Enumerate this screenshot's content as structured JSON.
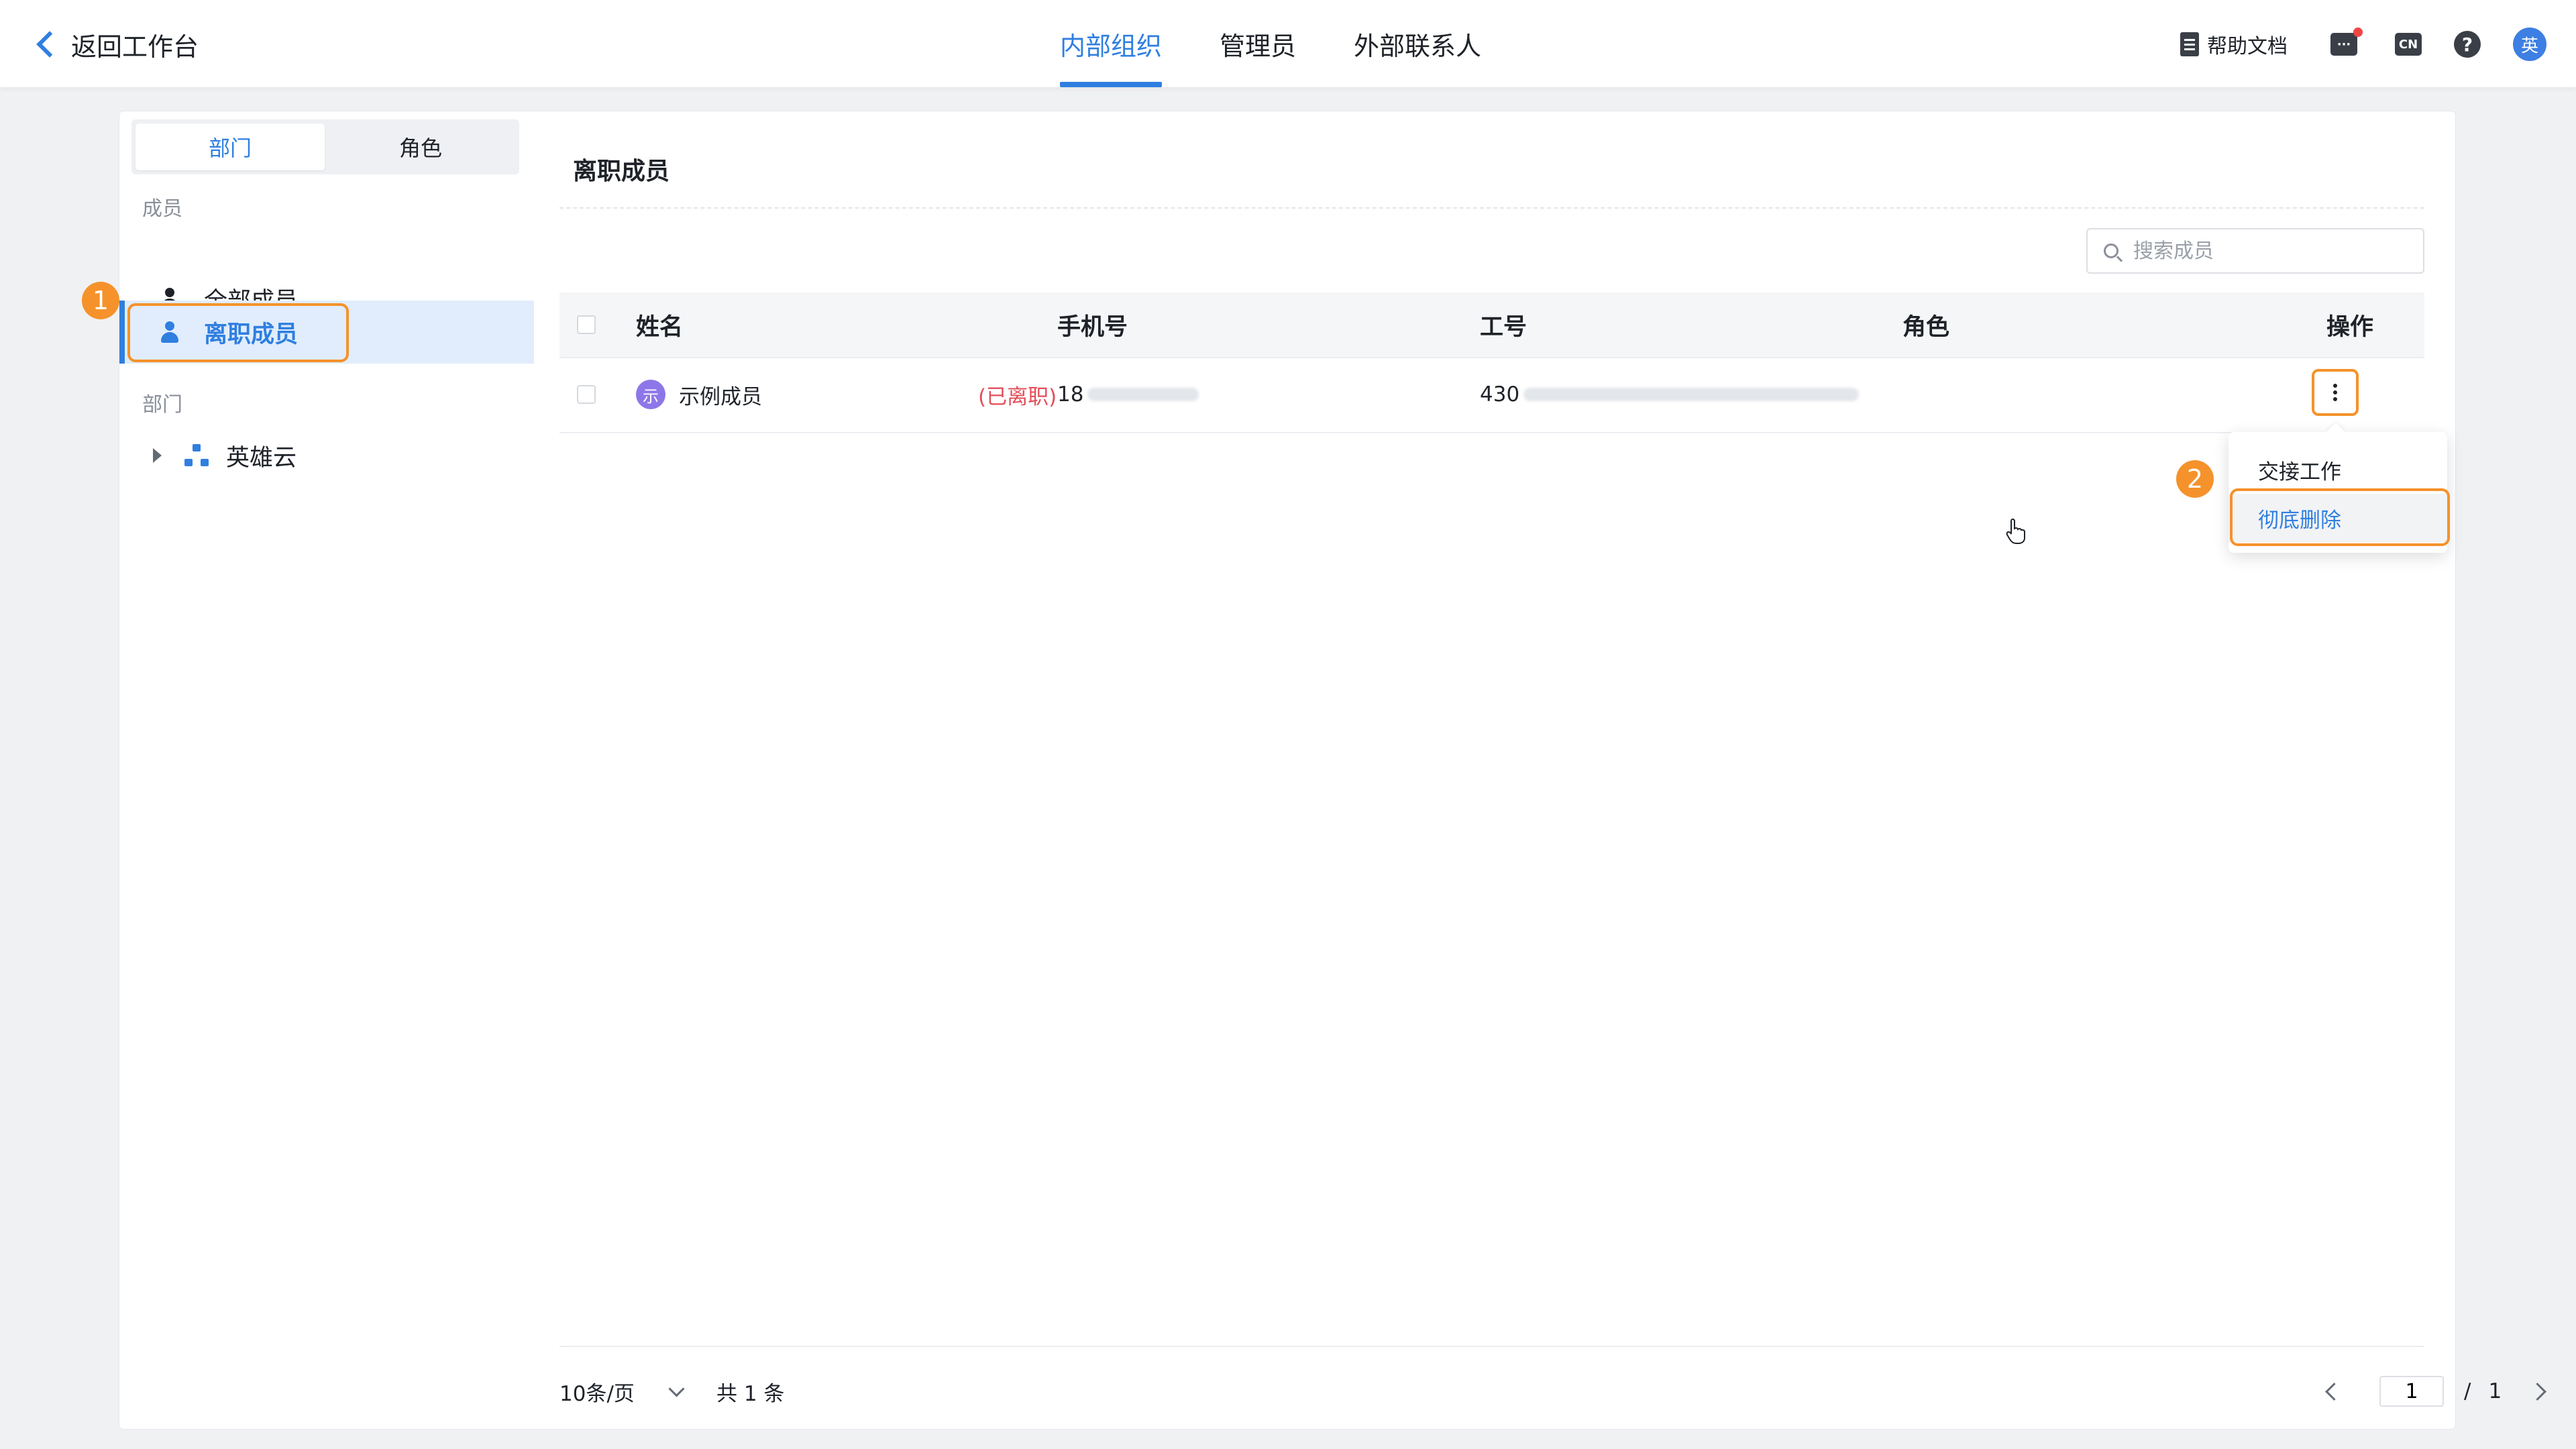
{
  "topbar": {
    "back_label": "返回工作台",
    "tabs": [
      {
        "label": "内部组织",
        "active": true
      },
      {
        "label": "管理员",
        "active": false
      },
      {
        "label": "外部联系人",
        "active": false
      }
    ],
    "help_doc_label": "帮助文档",
    "lang_icon_text": "CN",
    "help_icon_text": "?",
    "user_avatar_text": "英"
  },
  "sidebar": {
    "segments": [
      "部门",
      "角色"
    ],
    "members_section": "成员",
    "items": [
      {
        "label": "全部成员"
      },
      {
        "label": "离职成员"
      }
    ],
    "dept_section": "部门",
    "tree_root": "英雄云"
  },
  "main": {
    "title": "离职成员",
    "search_placeholder": "搜索成员",
    "columns": [
      "姓名",
      "手机号",
      "工号",
      "角色",
      "操作"
    ],
    "rows": [
      {
        "avatar": "示",
        "name": "示例成员",
        "status": "(已离职)",
        "phone_prefix": "18",
        "id_prefix": "430",
        "role": ""
      }
    ],
    "row_menu": [
      "交接工作",
      "彻底删除"
    ]
  },
  "callouts": [
    "1",
    "2"
  ],
  "pagination": {
    "page_size": "10条/页",
    "total": "共 1 条",
    "current": "1",
    "separator": "/",
    "pages": "1"
  },
  "colors": {
    "accent": "#2f7fe0",
    "highlight": "#f5922b",
    "danger": "#e34d59"
  }
}
